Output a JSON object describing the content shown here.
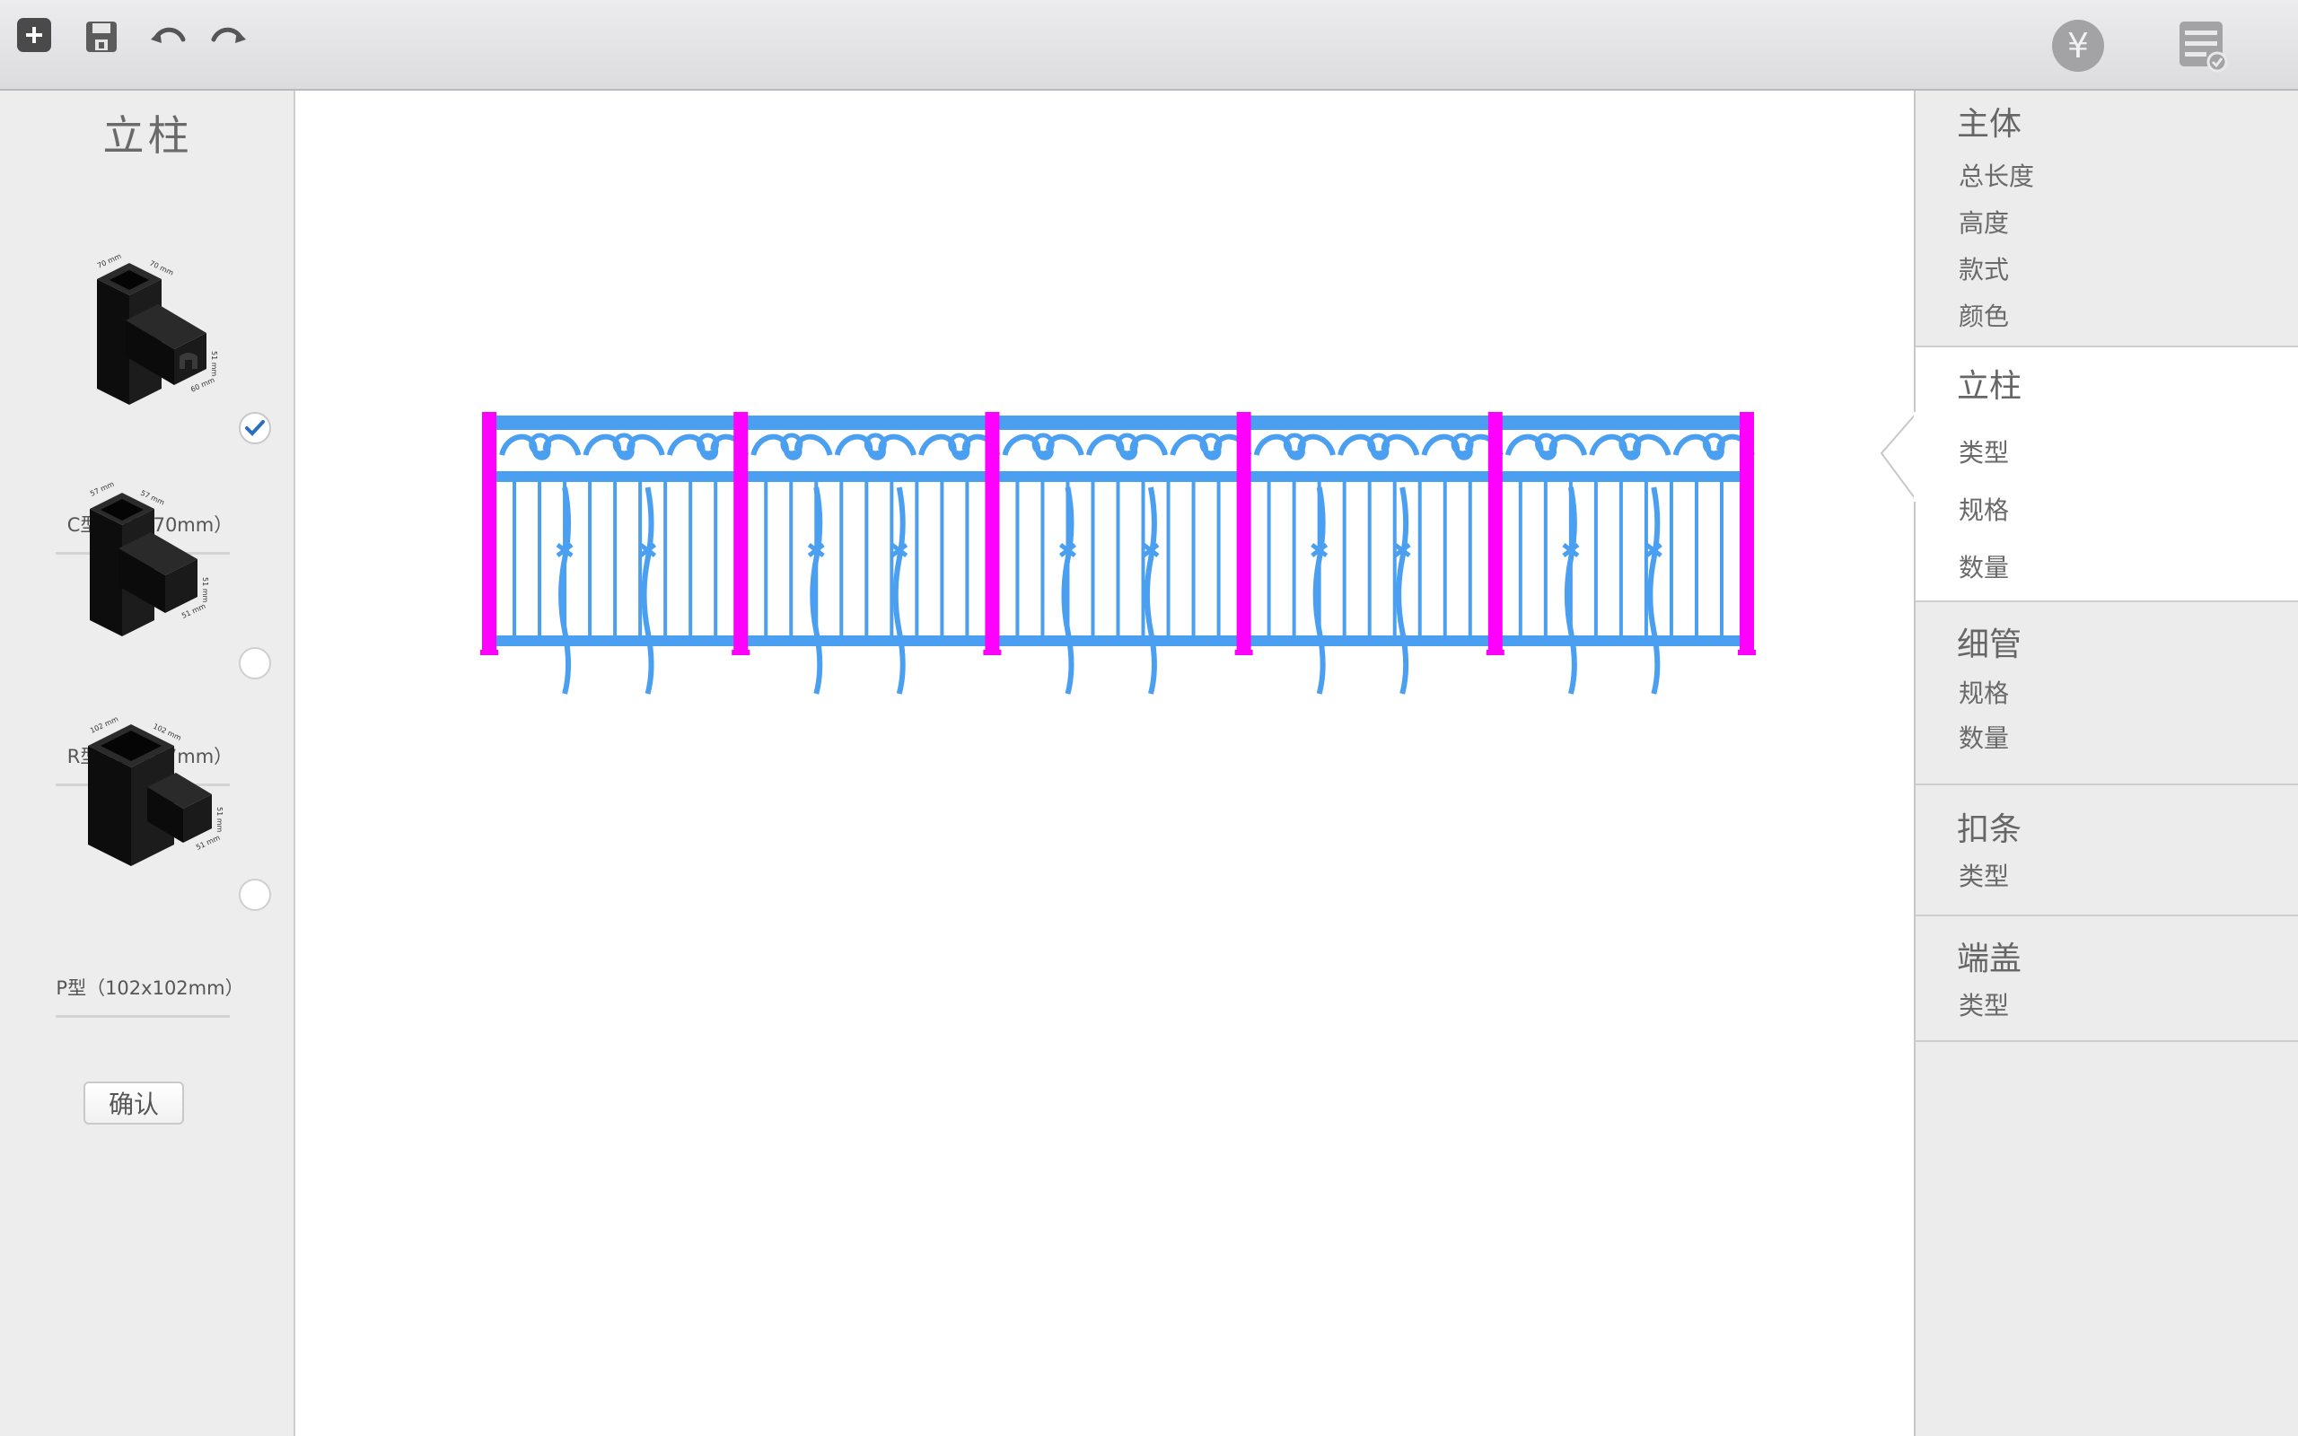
{
  "toolbar": {
    "icons": [
      "add-icon",
      "save-icon",
      "undo-icon",
      "redo-icon",
      "price-icon",
      "checklist-icon"
    ],
    "price_symbol": "¥"
  },
  "left_panel": {
    "title": "立柱",
    "options": [
      {
        "label": "C型（70x70mm）",
        "selected": true
      },
      {
        "label": "R型（57x57mm）",
        "selected": false
      },
      {
        "label": "P型（102x102mm）",
        "selected": false
      }
    ],
    "confirm_label": "确认"
  },
  "canvas": {
    "railing_panels": 5,
    "colors": {
      "rail": "#4a9ff0",
      "post": "#ff00ff"
    }
  },
  "right_panel": {
    "sections": [
      {
        "title": "主体",
        "items": [
          "总长度",
          "高度",
          "款式",
          "颜色"
        ],
        "active": false
      },
      {
        "title": "立柱",
        "items": [
          "类型",
          "规格",
          "数量"
        ],
        "active": true
      },
      {
        "title": "细管",
        "items": [
          "规格",
          "数量"
        ],
        "active": false
      },
      {
        "title": "扣条",
        "items": [
          "类型"
        ],
        "active": false
      },
      {
        "title": "端盖",
        "items": [
          "类型"
        ],
        "active": false
      }
    ]
  },
  "colors": {
    "accent_check": "#2a6fbb",
    "toolbar_bg": "#e4e4e6"
  }
}
